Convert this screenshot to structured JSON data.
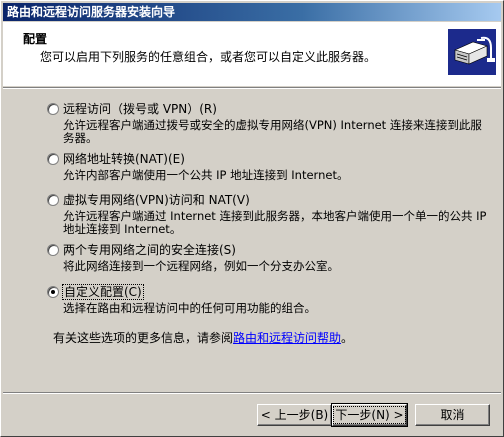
{
  "window": {
    "title": "路由和远程访问服务器安装向导"
  },
  "header": {
    "title": "配置",
    "subtitle": "您可以启用下列服务的任意组合，或者您可以自定义此服务器。",
    "icon": "server-network-icon"
  },
  "options": [
    {
      "label": "远程访问（拨号或 VPN）(R)",
      "description": "允许远程客户端通过拨号或安全的虚拟专用网络(VPN) Internet 连接来连接到此服务器。",
      "selected": false
    },
    {
      "label": "网络地址转换(NAT)(E)",
      "description": "允许内部客户端使用一个公共 IP 地址连接到 Internet。",
      "selected": false
    },
    {
      "label": "虚拟专用网络(VPN)访问和 NAT(V)",
      "description": "允许远程客户端通过 Internet 连接到此服务器，本地客户端使用一个单一的公共 IP 地址连接到 Internet。",
      "selected": false
    },
    {
      "label": "两个专用网络之间的安全连接(S)",
      "description": "将此网络连接到一个远程网络，例如一个分支办公室。",
      "selected": false
    },
    {
      "label": "自定义配置(C)",
      "description": "选择在路由和远程访问中的任何可用功能的组合。",
      "selected": true
    }
  ],
  "info": {
    "prefix": "有关这些选项的更多信息，请参阅",
    "link": "路由和远程访问帮助",
    "suffix": "。"
  },
  "buttons": {
    "back": "< 上一步(B)",
    "next": "下一步(N) >",
    "cancel": "取消"
  }
}
